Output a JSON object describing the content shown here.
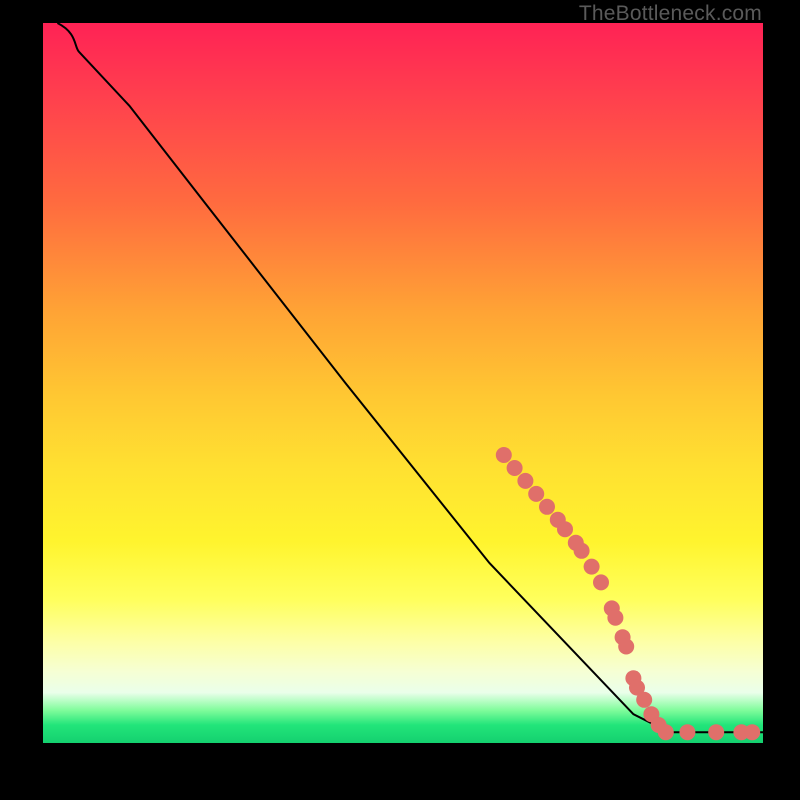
{
  "watermark": "TheBottleneck.com",
  "chart_data": {
    "type": "line",
    "title": "",
    "xlabel": "",
    "ylabel": "",
    "xlim": [
      0,
      100
    ],
    "ylim": [
      0,
      100
    ],
    "series": [
      {
        "name": "curve",
        "path_fraction": [
          [
            0.02,
            0.0
          ],
          [
            0.05,
            0.04
          ],
          [
            0.12,
            0.115
          ],
          [
            0.225,
            0.25
          ],
          [
            0.42,
            0.5
          ],
          [
            0.62,
            0.75
          ],
          [
            0.82,
            0.96
          ],
          [
            0.87,
            0.985
          ],
          [
            0.93,
            0.985
          ],
          [
            1.0,
            0.985
          ]
        ]
      },
      {
        "name": "points",
        "points_fraction": [
          [
            0.64,
            0.6
          ],
          [
            0.655,
            0.618
          ],
          [
            0.67,
            0.636
          ],
          [
            0.685,
            0.654
          ],
          [
            0.7,
            0.672
          ],
          [
            0.715,
            0.69
          ],
          [
            0.725,
            0.703
          ],
          [
            0.74,
            0.722
          ],
          [
            0.748,
            0.733
          ],
          [
            0.762,
            0.755
          ],
          [
            0.775,
            0.777
          ],
          [
            0.79,
            0.813
          ],
          [
            0.795,
            0.826
          ],
          [
            0.805,
            0.853
          ],
          [
            0.81,
            0.866
          ],
          [
            0.82,
            0.91
          ],
          [
            0.825,
            0.923
          ],
          [
            0.835,
            0.94
          ],
          [
            0.845,
            0.96
          ],
          [
            0.855,
            0.975
          ],
          [
            0.865,
            0.985
          ],
          [
            0.895,
            0.985
          ],
          [
            0.935,
            0.985
          ],
          [
            0.97,
            0.985
          ],
          [
            0.985,
            0.985
          ]
        ]
      }
    ],
    "gradient_stops": [
      {
        "pos": 0.0,
        "color": "#ff2255"
      },
      {
        "pos": 0.1,
        "color": "#ff3f4e"
      },
      {
        "pos": 0.25,
        "color": "#ff6b3f"
      },
      {
        "pos": 0.4,
        "color": "#ffa335"
      },
      {
        "pos": 0.52,
        "color": "#ffc832"
      },
      {
        "pos": 0.62,
        "color": "#ffe131"
      },
      {
        "pos": 0.72,
        "color": "#fff42e"
      },
      {
        "pos": 0.8,
        "color": "#ffff5c"
      },
      {
        "pos": 0.86,
        "color": "#fdffa7"
      },
      {
        "pos": 0.9,
        "color": "#f6ffd3"
      },
      {
        "pos": 0.93,
        "color": "#eaffea"
      },
      {
        "pos": 0.955,
        "color": "#7efc9a"
      },
      {
        "pos": 0.975,
        "color": "#22e57a"
      },
      {
        "pos": 1.0,
        "color": "#14d06f"
      }
    ]
  }
}
